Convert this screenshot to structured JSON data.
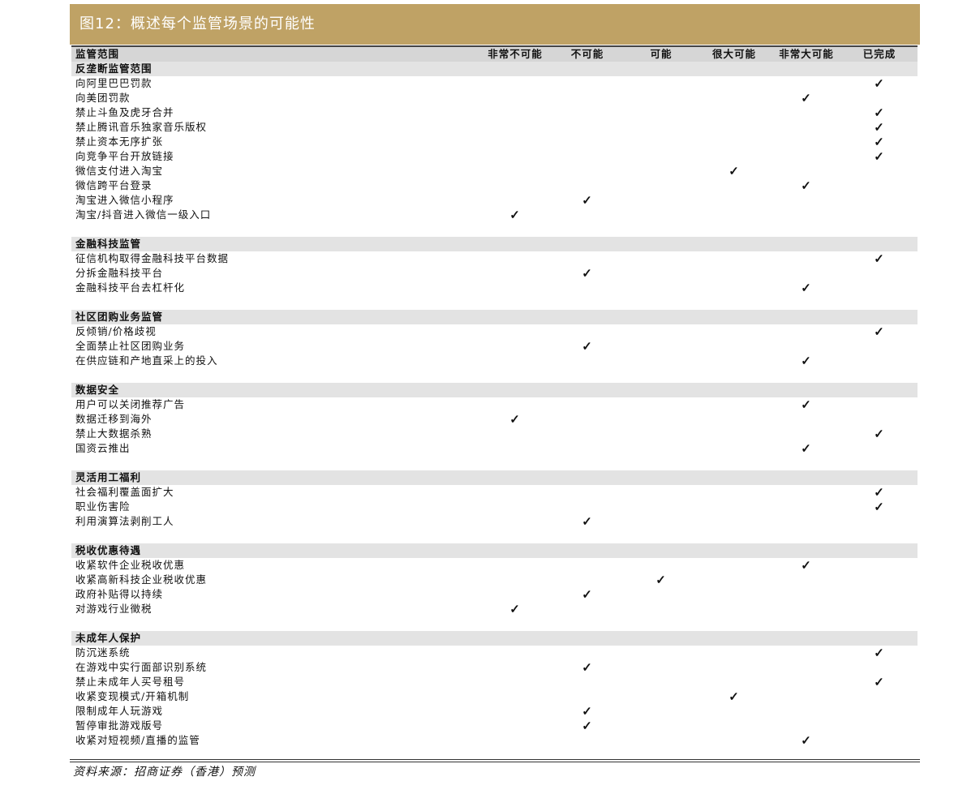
{
  "title": "图12：概述每个监管场景的可能性",
  "columns": {
    "first": "监管范围",
    "levels": [
      "非常不可能",
      "不可能",
      "可能",
      "很大可能",
      "非常大可能",
      "已完成"
    ]
  },
  "check_mark": "✓",
  "sections": [
    {
      "name": "反垄断监管范围",
      "items": [
        {
          "label": "向阿里巴巴罚款",
          "level": 5
        },
        {
          "label": "向美团罚款",
          "level": 4
        },
        {
          "label": "禁止斗鱼及虎牙合并",
          "level": 5
        },
        {
          "label": "禁止腾讯音乐独家音乐版权",
          "level": 5
        },
        {
          "label": "禁止资本无序扩张",
          "level": 5
        },
        {
          "label": "向竞争平台开放链接",
          "level": 5
        },
        {
          "label": "微信支付进入淘宝",
          "level": 3
        },
        {
          "label": "微信跨平台登录",
          "level": 4
        },
        {
          "label": "淘宝进入微信小程序",
          "level": 1
        },
        {
          "label": "淘宝/抖音进入微信一级入口",
          "level": 0
        }
      ]
    },
    {
      "name": "金融科技监管",
      "items": [
        {
          "label": "征信机构取得金融科技平台数据",
          "level": 5
        },
        {
          "label": "分拆金融科技平台",
          "level": 1
        },
        {
          "label": "金融科技平台去杠杆化",
          "level": 4
        }
      ]
    },
    {
      "name": "社区团购业务监管",
      "items": [
        {
          "label": "反倾销/价格歧视",
          "level": 5
        },
        {
          "label": "全面禁止社区团购业务",
          "level": 1
        },
        {
          "label": "在供应链和产地直采上的投入",
          "level": 4
        }
      ]
    },
    {
      "name": "数据安全",
      "items": [
        {
          "label": "用户可以关闭推荐广告",
          "level": 4
        },
        {
          "label": "数据迁移到海外",
          "level": 0
        },
        {
          "label": "禁止大数据杀熟",
          "level": 5
        },
        {
          "label": "国资云推出",
          "level": 4
        }
      ]
    },
    {
      "name": "灵活用工福利",
      "items": [
        {
          "label": "社会福利覆盖面扩大",
          "level": 5
        },
        {
          "label": "职业伤害险",
          "level": 5
        },
        {
          "label": "利用演算法剥削工人",
          "level": 1
        }
      ]
    },
    {
      "name": "税收优惠待遇",
      "items": [
        {
          "label": "收紧软件企业税收优惠",
          "level": 4
        },
        {
          "label": "收紧高新科技企业税收优惠",
          "level": 2
        },
        {
          "label": "政府补贴得以持续",
          "level": 1
        },
        {
          "label": "对游戏行业徵税",
          "level": 0
        }
      ]
    },
    {
      "name": "未成年人保护",
      "items": [
        {
          "label": "防沉迷系统",
          "level": 5
        },
        {
          "label": "在游戏中实行面部识别系统",
          "level": 1
        },
        {
          "label": "禁止未成年人买号租号",
          "level": 5
        },
        {
          "label": "收紧变现模式/开箱机制",
          "level": 3
        },
        {
          "label": "限制成年人玩游戏",
          "level": 1
        },
        {
          "label": "暂停审批游戏版号",
          "level": 1
        },
        {
          "label": "收紧对短视频/直播的监管",
          "level": 4
        }
      ]
    }
  ],
  "source": "资料来源：招商证券（香港）预测"
}
